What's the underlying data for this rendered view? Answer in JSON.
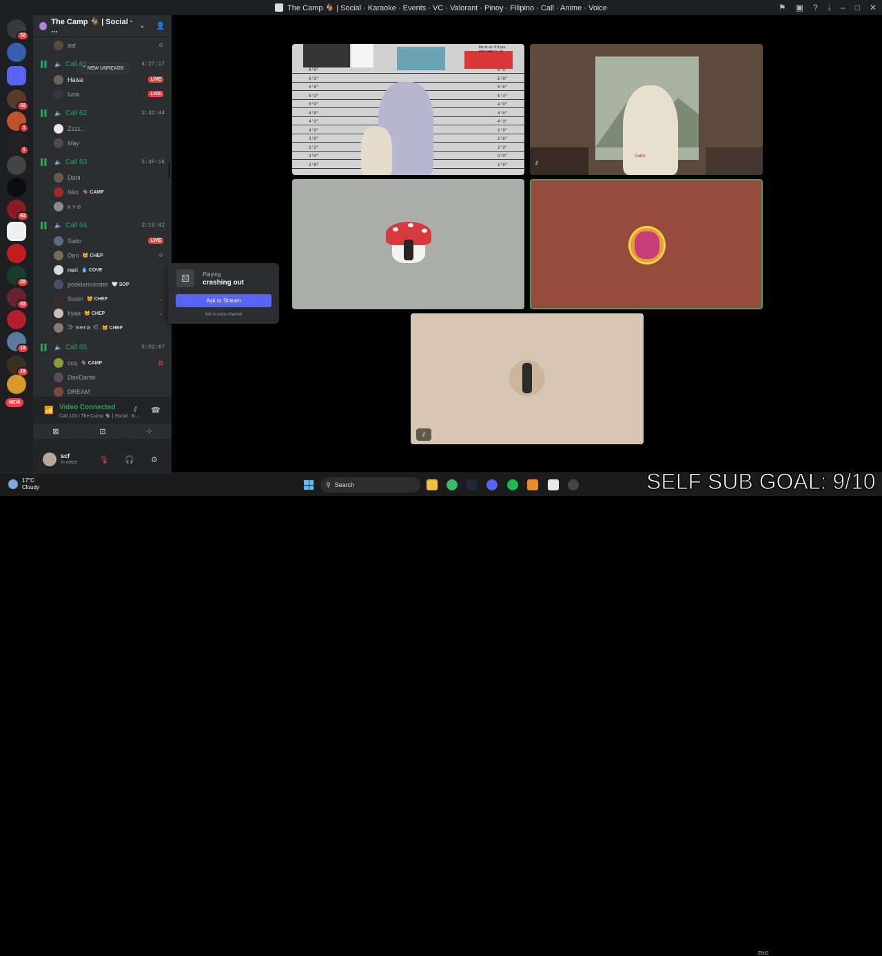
{
  "window": {
    "title": "The Camp 🐐 | Social · Karaoke · Events · VC · Valorant · Pinoy · Filipino · Call · Anime · Voice"
  },
  "server": {
    "name": "The Camp 🐐 | Social · ...",
    "new_unreads": "NEW UNREADS",
    "partial_member": "ast",
    "badges": [
      "32",
      "32",
      "1",
      "1",
      "62",
      "20",
      "43",
      "16",
      "19"
    ],
    "new_label": "NEW"
  },
  "calls": [
    {
      "name": "Call 61",
      "time": "4:27:17",
      "members": [
        {
          "name": "Haise",
          "live": "LIVE"
        },
        {
          "name": "luna",
          "live": "LIVE"
        }
      ]
    },
    {
      "name": "Call 62",
      "time": "3:42:44",
      "members": [
        {
          "name": "Zzzz..."
        },
        {
          "name": "May"
        }
      ]
    },
    {
      "name": "Call 63",
      "time": "3:49:16",
      "members": [
        {
          "name": "Dani"
        },
        {
          "name": "Isko",
          "tag": "CAMP"
        },
        {
          "name": "ᴋ ʏ ᴏ"
        }
      ]
    },
    {
      "name": "Call 64",
      "time": "3:19:42",
      "members": [
        {
          "name": "Saito",
          "live": "LIVE"
        },
        {
          "name": "Den",
          "tag": "CHEP"
        },
        {
          "name": "neri",
          "tag": "COVE"
        },
        {
          "name": "pookiemonster",
          "tag": "SOP"
        },
        {
          "name": "Sooin",
          "tag": "CHEP"
        },
        {
          "name": "Ilyaa",
          "tag": "CHEP"
        },
        {
          "name": "⋺ 𝘀𝗲𝗿𝗮 ⋲",
          "tag": "CHEP"
        }
      ]
    },
    {
      "name": "Call 65",
      "time": "5:02:07",
      "members": [
        {
          "name": "ccq",
          "tag": "CAMP"
        },
        {
          "name": "DaeDante"
        },
        {
          "name": "DREAM"
        }
      ]
    }
  ],
  "voice_panel": {
    "status": "Video Connected",
    "location": "Call 123 / The Camp 🐐 | Social · K...",
    "user_name": "scf",
    "user_status": "In voice"
  },
  "popup": {
    "playing_label": "Playing",
    "game": "crashing out",
    "button": "Ask to Stream",
    "note": "Not in voice channel"
  },
  "tiles": {
    "height_labels_left": [
      "6'6\"",
      "6'3\"",
      "5'6\"",
      "5'3\"",
      "5'0\"",
      "4'6\"",
      "4'3\"",
      "4'0\"",
      "3'6\"",
      "3'3\"",
      "3'0\"",
      "2'6\""
    ],
    "height_labels_right": [
      "6'0\"",
      "5'9\"",
      "5'6\"",
      "5'3\"",
      "4'9\"",
      "4'6\"",
      "4'3\"",
      "3'9\"",
      "3'6\"",
      "3'3\"",
      "3'0\"",
      "2'6\""
    ],
    "thumb_caption": "this is us :3 if you ever care :>. <3",
    "shirt_text": "Garlic"
  },
  "taskbar": {
    "temp": "17°C",
    "weather": "Cloudy",
    "search_placeholder": "Search",
    "overlay_text": "SELF SUB GOAL: 9/10",
    "tray_lang": "ENG"
  },
  "colors": {
    "accent": "#5865f2",
    "online": "#23a55a",
    "live": "#ed4245",
    "sidebar": "#2b2d31",
    "rail": "#1e1f22"
  }
}
